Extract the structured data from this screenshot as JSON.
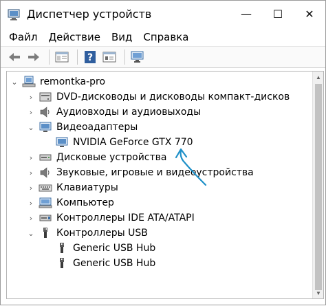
{
  "window": {
    "title": "Диспетчер устройств",
    "controls": {
      "minimize": "—",
      "maximize": "☐",
      "close": "✕"
    }
  },
  "menu": {
    "items": [
      "Файл",
      "Действие",
      "Вид",
      "Справка"
    ]
  },
  "toolbar": {
    "buttons": [
      "back-icon",
      "forward-icon",
      "show-hide-tree-icon",
      "help-icon",
      "properties-icon",
      "monitor-scan-icon"
    ]
  },
  "tree": {
    "root": "remontka-pro",
    "items": [
      {
        "label": "DVD-дисководы и дисководы компакт-дисков",
        "expander": "›",
        "icon": "dvd-drive-icon"
      },
      {
        "label": "Аудиовходы и аудиовыходы",
        "expander": "›",
        "icon": "speaker-icon"
      },
      {
        "label": "Видеоадаптеры",
        "expander": "⌄",
        "icon": "display-adapter-icon"
      },
      {
        "label": "NVIDIA GeForce GTX 770",
        "expander": "",
        "icon": "display-adapter-icon",
        "child": true
      },
      {
        "label": "Дисковые устройства",
        "expander": "›",
        "icon": "disk-drive-icon"
      },
      {
        "label": "Звуковые, игровые и видеоустройства",
        "expander": "›",
        "icon": "speaker-icon"
      },
      {
        "label": "Клавиатуры",
        "expander": "›",
        "icon": "keyboard-icon"
      },
      {
        "label": "Компьютер",
        "expander": "›",
        "icon": "computer-icon"
      },
      {
        "label": "Контроллеры IDE ATA/ATAPI",
        "expander": "›",
        "icon": "ide-controller-icon"
      },
      {
        "label": "Контроллеры USB",
        "expander": "⌄",
        "icon": "usb-icon"
      },
      {
        "label": "Generic USB Hub",
        "expander": "",
        "icon": "usb-plug-icon",
        "child": true
      },
      {
        "label": "Generic USB Hub",
        "expander": "",
        "icon": "usb-plug-icon",
        "child": true
      }
    ]
  },
  "colors": {
    "annotation_arrow": "#1e90c8",
    "selection": "#cfe5ff"
  }
}
